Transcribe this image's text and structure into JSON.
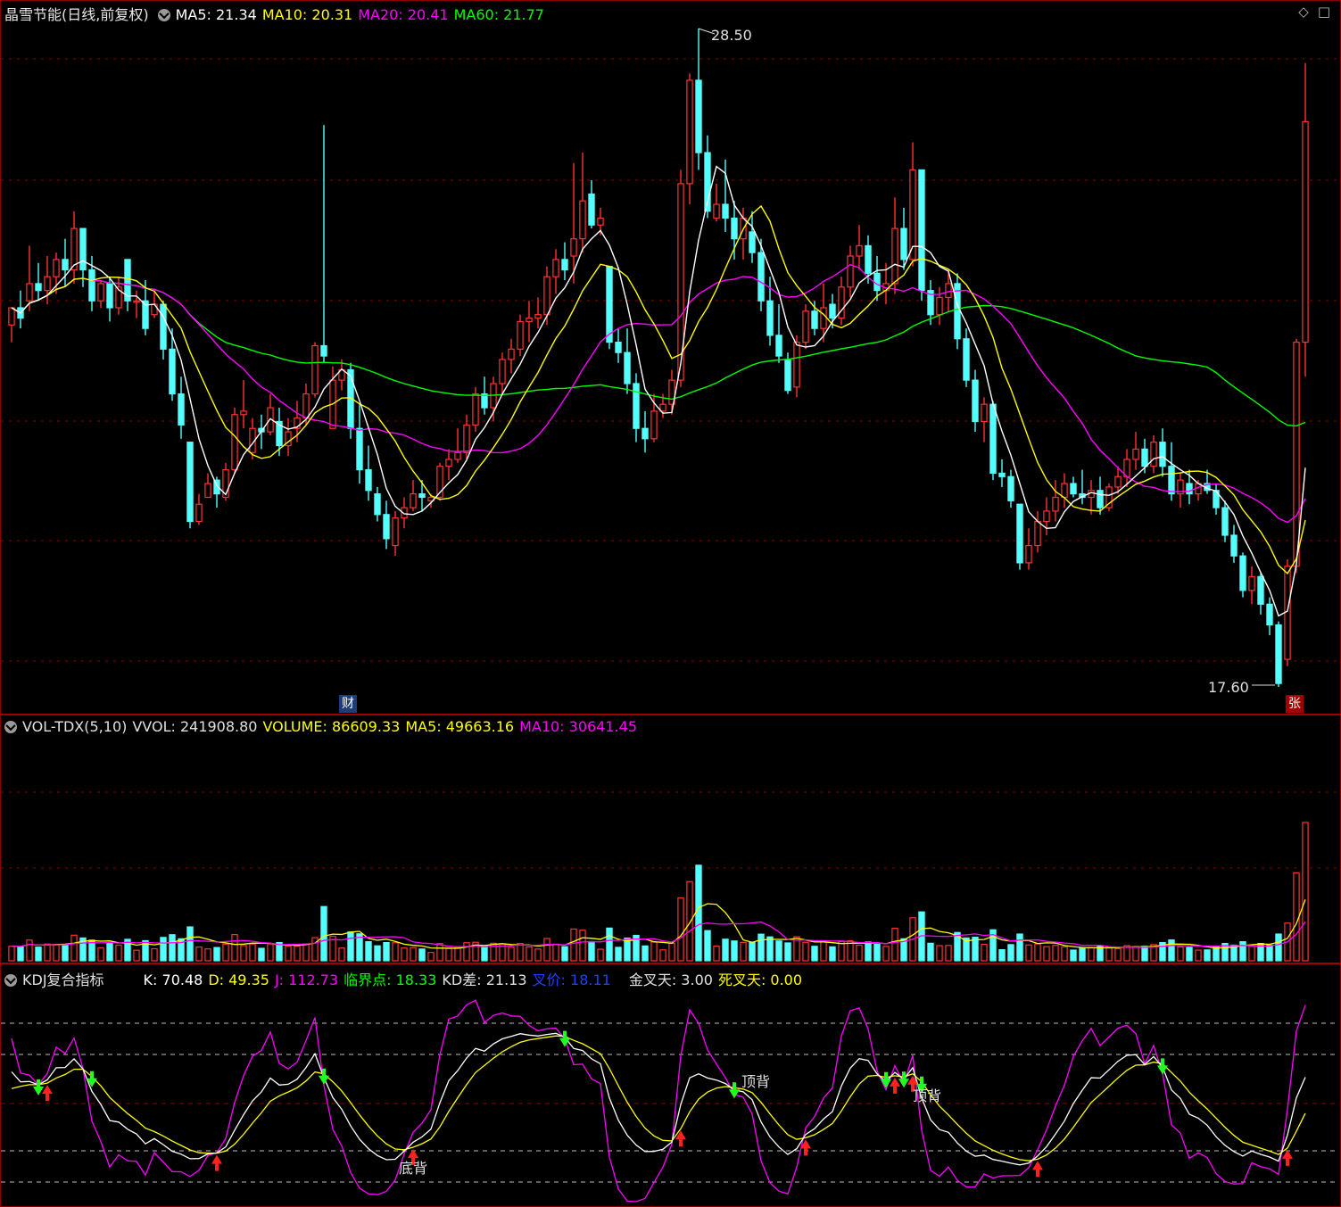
{
  "main": {
    "stock_name": "晶雪节能",
    "mode": "(日线,前复权)",
    "ma5": "MA5: 21.34",
    "ma10": "MA10: 20.31",
    "ma20": "MA20: 20.41",
    "ma60": "MA60: 21.77",
    "high_label": "28.50",
    "low_label": "17.60",
    "cai_badge": "财",
    "zhang_badge": "张",
    "icons": [
      "diamond-icon",
      "maximize-icon"
    ]
  },
  "vol": {
    "title": "VOL-TDX(5,10)",
    "vvol": "VVOL: 241908.80",
    "volume": "VOLUME: 86609.33",
    "ma5": "MA5: 49663.16",
    "ma10": "MA10: 30641.45"
  },
  "kdj": {
    "title": "KDJ复合指标",
    "k": "K: 70.48",
    "d": "D: 49.35",
    "j": "J: 112.73",
    "critical": "临界点: 18.33",
    "kd_diff": "KD差: 21.13",
    "cross_price": "叉价: 18.11",
    "golden_days": "金叉天: 3.00",
    "death_days": "死叉天: 0.00",
    "labels": {
      "top1": "顶背",
      "top2": "顶背",
      "bottom": "底背"
    }
  },
  "colors": {
    "up": "#ff3232",
    "down": "#54ffff",
    "ma5": "#ffffff",
    "ma10": "#ffff00",
    "ma20": "#ff00ff",
    "ma60": "#00ff00",
    "grid": "#8a0000",
    "cross_price": "#2040ff"
  },
  "chart_data": {
    "type": "candlestick",
    "count": 100,
    "candles": [
      [
        19.9,
        20.4,
        19.4,
        20.4
      ],
      [
        20.4,
        20.9,
        19.8,
        20.1
      ],
      [
        20.6,
        22.2,
        20.3,
        21.1
      ],
      [
        21.1,
        21.7,
        20.6,
        20.9
      ],
      [
        20.9,
        21.9,
        20.5,
        21.3
      ],
      [
        21.3,
        22.0,
        20.8,
        21.8
      ],
      [
        21.8,
        22.4,
        21.0,
        21.5
      ],
      [
        21.5,
        23.2,
        21.1,
        22.7
      ],
      [
        22.7,
        22.7,
        21.0,
        21.5
      ],
      [
        21.5,
        21.9,
        20.3,
        20.6
      ],
      [
        20.6,
        21.2,
        20.4,
        21.1
      ],
      [
        21.1,
        21.3,
        20.0,
        20.4
      ],
      [
        20.4,
        21.3,
        20.2,
        21.0
      ],
      [
        21.8,
        21.8,
        20.3,
        20.6
      ],
      [
        20.6,
        20.9,
        20.1,
        20.6
      ],
      [
        20.6,
        21.2,
        19.6,
        19.8
      ],
      [
        20.2,
        20.9,
        20.1,
        20.5
      ],
      [
        20.5,
        20.6,
        18.9,
        19.2
      ],
      [
        19.2,
        19.8,
        17.7,
        17.9
      ],
      [
        17.9,
        18.4,
        16.6,
        17.0
      ],
      [
        16.5,
        16.5,
        14.0,
        14.2
      ],
      [
        14.2,
        15.0,
        14.1,
        14.7
      ],
      [
        14.9,
        15.6,
        14.9,
        15.3
      ],
      [
        15.4,
        15.5,
        14.6,
        15.0
      ],
      [
        14.9,
        15.9,
        14.8,
        15.7
      ],
      [
        15.7,
        17.5,
        15.6,
        17.3
      ],
      [
        17.3,
        18.3,
        16.9,
        17.4
      ],
      [
        16.2,
        17.2,
        16.0,
        16.9
      ],
      [
        16.9,
        17.3,
        16.3,
        16.8
      ],
      [
        16.8,
        17.9,
        16.7,
        17.5
      ],
      [
        17.1,
        17.5,
        16.1,
        16.4
      ],
      [
        16.4,
        17.2,
        16.1,
        16.8
      ],
      [
        16.9,
        17.7,
        16.5,
        17.2
      ],
      [
        17.2,
        18.2,
        17.0,
        17.9
      ],
      [
        17.9,
        19.4,
        17.8,
        19.3
      ],
      [
        19.3,
        25.7,
        18.8,
        19.0
      ],
      [
        16.9,
        18.7,
        16.9,
        18.3
      ],
      [
        18.3,
        18.9,
        18.0,
        18.6
      ],
      [
        18.6,
        18.8,
        16.6,
        16.9
      ],
      [
        16.9,
        17.6,
        15.3,
        15.7
      ],
      [
        15.7,
        16.4,
        14.8,
        15.1
      ],
      [
        15.0,
        15.2,
        14.2,
        14.4
      ],
      [
        14.4,
        14.8,
        13.4,
        13.7
      ],
      [
        13.5,
        14.5,
        13.2,
        14.3
      ],
      [
        14.3,
        14.9,
        14.0,
        14.6
      ],
      [
        14.6,
        15.4,
        14.5,
        15.0
      ],
      [
        15.0,
        15.4,
        14.5,
        14.9
      ],
      [
        14.8,
        15.0,
        14.6,
        14.9
      ],
      [
        14.9,
        15.9,
        14.8,
        15.8
      ],
      [
        15.8,
        16.3,
        15.4,
        16.0
      ],
      [
        16.0,
        16.9,
        15.9,
        16.2
      ],
      [
        16.2,
        17.3,
        16.0,
        17.0
      ],
      [
        17.0,
        18.1,
        16.8,
        17.9
      ],
      [
        17.9,
        18.4,
        17.3,
        17.5
      ],
      [
        17.5,
        18.4,
        17.1,
        18.2
      ],
      [
        18.2,
        19.1,
        17.9,
        18.9
      ],
      [
        18.9,
        19.5,
        18.5,
        19.2
      ],
      [
        19.2,
        20.2,
        19.0,
        20.0
      ],
      [
        20.0,
        20.6,
        19.4,
        20.1
      ],
      [
        20.1,
        20.7,
        19.8,
        20.2
      ],
      [
        20.2,
        21.6,
        19.9,
        21.3
      ],
      [
        21.3,
        22.1,
        20.8,
        21.8
      ],
      [
        21.8,
        22.3,
        21.2,
        21.5
      ],
      [
        21.9,
        24.6,
        21.1,
        22.4
      ],
      [
        22.4,
        24.9,
        22.0,
        23.5
      ],
      [
        23.7,
        24.1,
        22.7,
        22.8
      ],
      [
        22.8,
        23.3,
        22.5,
        23.0
      ],
      [
        21.6,
        21.6,
        19.2,
        19.4
      ],
      [
        19.4,
        19.8,
        18.8,
        19.1
      ],
      [
        19.1,
        19.8,
        17.9,
        18.2
      ],
      [
        18.2,
        18.5,
        16.5,
        16.9
      ],
      [
        16.9,
        17.4,
        16.2,
        16.6
      ],
      [
        16.6,
        17.9,
        16.5,
        17.4
      ],
      [
        17.4,
        17.9,
        17.2,
        17.6
      ],
      [
        17.6,
        18.6,
        17.3,
        18.3
      ],
      [
        18.3,
        24.4,
        18.1,
        24.0
      ],
      [
        24.0,
        27.2,
        23.4,
        27.0
      ],
      [
        27.0,
        28.5,
        24.4,
        24.9
      ],
      [
        24.9,
        25.4,
        23.0,
        23.2
      ],
      [
        23.0,
        24.0,
        22.9,
        23.4
      ],
      [
        23.4,
        24.7,
        22.6,
        23.0
      ],
      [
        23.0,
        23.5,
        21.8,
        22.4
      ],
      [
        22.4,
        23.3,
        21.8,
        23.0
      ],
      [
        22.6,
        23.2,
        21.7,
        22.0
      ],
      [
        22.0,
        22.4,
        20.3,
        20.6
      ],
      [
        20.6,
        21.3,
        19.3,
        19.6
      ],
      [
        19.6,
        20.5,
        18.8,
        19.0
      ],
      [
        18.9,
        19.1,
        17.9,
        18.0
      ],
      [
        18.1,
        19.6,
        17.8,
        19.4
      ],
      [
        19.4,
        20.5,
        19.2,
        20.3
      ],
      [
        20.3,
        20.6,
        19.6,
        19.8
      ],
      [
        19.8,
        21.1,
        19.4,
        20.4
      ],
      [
        20.5,
        20.8,
        19.8,
        20.1
      ],
      [
        20.1,
        21.3,
        19.9,
        21.0
      ],
      [
        21.0,
        22.2,
        20.7,
        21.9
      ],
      [
        21.9,
        22.8,
        21.5,
        22.2
      ],
      [
        22.2,
        22.5,
        21.1,
        21.4
      ],
      [
        21.4,
        21.9,
        20.6,
        20.9
      ],
      [
        20.9,
        21.7,
        20.5,
        21.1
      ],
      [
        21.1,
        23.6,
        20.8,
        22.7
      ]
    ],
    "candles_tail": [
      [
        22.7,
        23.3,
        21.5,
        21.8
      ],
      [
        21.8,
        25.2,
        21.6,
        24.4
      ],
      [
        24.4,
        24.4,
        20.6,
        20.9
      ],
      [
        20.9,
        21.2,
        19.9,
        20.2
      ],
      [
        20.2,
        21.0,
        19.9,
        20.7
      ],
      [
        20.7,
        21.5,
        20.3,
        21.1
      ],
      [
        21.1,
        21.4,
        19.2,
        19.5
      ],
      [
        19.5,
        19.8,
        18.1,
        18.3
      ],
      [
        18.3,
        18.6,
        16.8,
        17.1
      ],
      [
        17.1,
        17.8,
        16.5,
        17.6
      ],
      [
        17.6,
        17.7,
        15.4,
        15.6
      ],
      [
        15.6,
        16.0,
        15.2,
        15.5
      ],
      [
        15.5,
        15.7,
        14.6,
        14.8
      ],
      [
        14.7,
        14.7,
        12.8,
        13.0
      ],
      [
        13.0,
        14.0,
        12.8,
        13.5
      ],
      [
        13.5,
        14.5,
        13.3,
        14.2
      ],
      [
        14.2,
        14.9,
        13.8,
        14.5
      ],
      [
        14.5,
        15.4,
        14.2,
        14.9
      ],
      [
        14.9,
        15.6,
        14.6,
        15.3
      ],
      [
        15.3,
        15.5,
        14.9,
        15.0
      ],
      [
        15.0,
        15.7,
        14.7,
        14.9
      ],
      [
        14.9,
        15.4,
        14.4,
        15.1
      ],
      [
        15.1,
        15.5,
        14.4,
        14.6
      ],
      [
        14.6,
        15.3,
        14.5,
        15.2
      ],
      [
        15.2,
        15.8,
        15.0,
        15.5
      ],
      [
        15.5,
        16.3,
        15.2,
        16.0
      ],
      [
        16.0,
        16.8,
        15.7,
        16.3
      ],
      [
        16.3,
        16.6,
        15.6,
        15.8
      ],
      [
        15.8,
        16.7,
        15.6,
        16.5
      ],
      [
        16.5,
        16.9,
        15.5,
        15.8
      ],
      [
        15.8,
        16.5,
        14.8,
        15.0
      ],
      [
        15.0,
        15.6,
        14.6,
        15.4
      ],
      [
        15.3,
        15.7,
        14.7,
        15.0
      ],
      [
        15.0,
        15.4,
        14.8,
        15.3
      ],
      [
        15.3,
        15.7,
        15.0,
        15.1
      ],
      [
        15.1,
        15.3,
        14.4,
        14.6
      ],
      [
        14.6,
        14.8,
        13.6,
        13.8
      ],
      [
        13.8,
        14.1,
        13.0,
        13.2
      ],
      [
        13.2,
        13.3,
        12.0,
        12.2
      ],
      [
        12.2,
        12.9,
        11.8,
        12.6
      ],
      [
        12.6,
        12.7,
        11.5,
        11.8
      ],
      [
        11.8,
        12.0,
        10.9,
        11.2
      ],
      [
        11.2,
        11.3,
        9.4,
        9.5
      ],
      [
        10.2,
        13.1,
        10.0,
        12.9
      ],
      [
        12.9,
        19.5,
        12.7,
        19.4
      ],
      [
        19.4,
        27.5,
        18.4,
        25.8
      ]
    ],
    "ylim": [
      9.4,
      28.5
    ]
  }
}
